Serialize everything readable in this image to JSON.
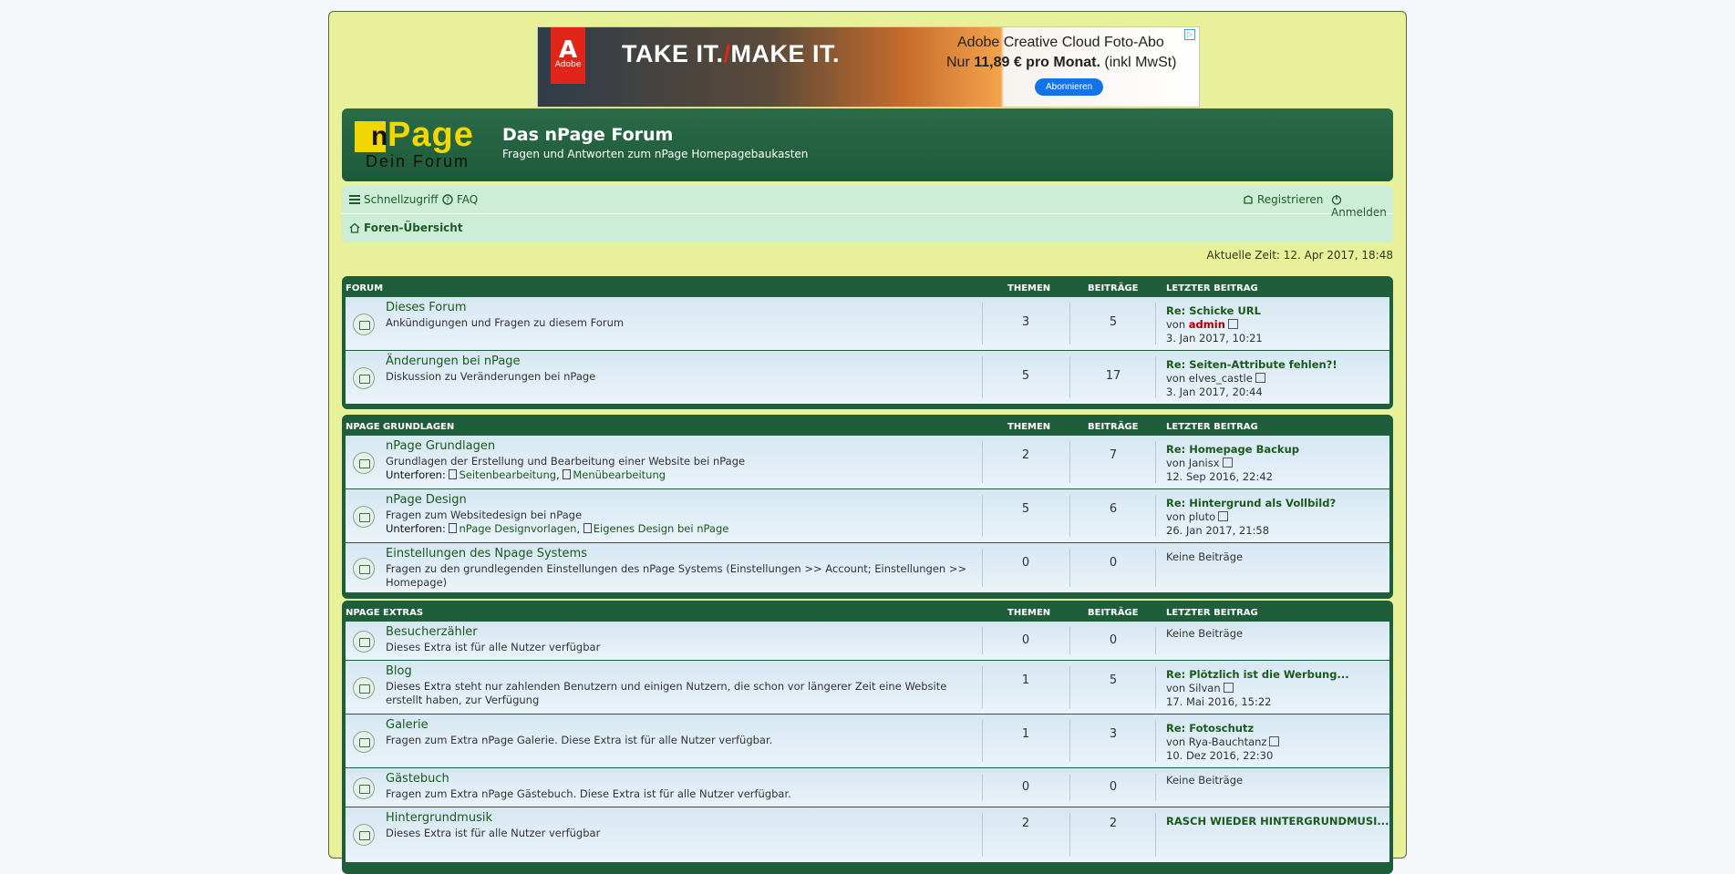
{
  "ad": {
    "logo_text": "Adobe",
    "headline_a": "TAKE IT.",
    "headline_b": "MAKE IT.",
    "line1": "Adobe Creative Cloud Foto-Abo",
    "line2_pre": "Nur ",
    "line2_price": "11,89 € pro Monat.",
    "line2_post": " (inkl MwSt)",
    "button": "Abonnieren"
  },
  "header": {
    "logo_n": "n",
    "logo_page": "Page",
    "logo_sub": "Dein Forum",
    "title": "Das nPage Forum",
    "subtitle": "Fragen und Antworten zum nPage Homepagebaukasten"
  },
  "nav": {
    "quick": "Schnellzugriff",
    "faq": "FAQ",
    "register": "Registrieren",
    "login": "Anmelden",
    "breadcrumb": "Foren-Übersicht"
  },
  "current_time": "Aktuelle Zeit: 12. Apr 2017, 18:48",
  "columns": {
    "topics": "THEMEN",
    "posts": "BEITRÄGE",
    "last": "LETZTER BEITRAG"
  },
  "categories": [
    {
      "name": "FORUM",
      "forums": [
        {
          "title": "Dieses Forum",
          "desc": "Ankündigungen und Fragen zu diesem Forum",
          "topics": "3",
          "posts": "5",
          "last_title": "Re: Schicke URL",
          "by": "von ",
          "author": "admin",
          "date": "3. Jan 2017, 10:21"
        },
        {
          "title": "Änderungen bei nPage",
          "desc": "Diskussion zu Veränderungen bei nPage",
          "topics": "5",
          "posts": "17",
          "last_title": "Re: Seiten-Attribute fehlen?!",
          "by": "von ",
          "author": "elves_castle",
          "date": "3. Jan 2017, 20:44"
        }
      ]
    },
    {
      "name": "NPAGE GRUNDLAGEN",
      "forums": [
        {
          "title": "nPage Grundlagen",
          "desc": "Grundlagen der Erstellung und Bearbeitung einer Website bei nPage",
          "sub_label": "Unterforen:",
          "sub1": "Seitenbearbeitung",
          "sub2": "Menübearbeitung",
          "topics": "2",
          "posts": "7",
          "last_title": "Re: Homepage Backup",
          "by": "von ",
          "author": "Janisx",
          "date": "12. Sep 2016, 22:42"
        },
        {
          "title": "nPage Design",
          "desc": "Fragen zum Websitedesign bei nPage",
          "sub_label": "Unterforen:",
          "sub1": "nPage Designvorlagen",
          "sub2": "Eigenes Design bei nPage",
          "topics": "5",
          "posts": "6",
          "last_title": "Re: Hintergrund als Vollbild?",
          "by": "von ",
          "author": "pluto",
          "date": "26. Jan 2017, 21:58"
        },
        {
          "title": "Einstellungen des Npage Systems",
          "desc": "Fragen zu den grundlegenden Einstellungen des nPage Systems (Einstellungen >> Account; Einstellungen >> Homepage)",
          "topics": "0",
          "posts": "0",
          "none": "Keine Beiträge"
        }
      ]
    },
    {
      "name": "NPAGE EXTRAS",
      "forums": [
        {
          "title": "Besucherzähler",
          "desc": "Dieses Extra ist für alle Nutzer verfügbar",
          "topics": "0",
          "posts": "0",
          "none": "Keine Beiträge"
        },
        {
          "title": "Blog",
          "desc": "Dieses Extra steht nur zahlenden Benutzern und einigen Nutzern, die schon vor längerer Zeit eine Website erstellt haben, zur Verfügung",
          "topics": "1",
          "posts": "5",
          "last_title": "Re: Plötzlich ist die Werbung...",
          "by": "von ",
          "author": "Silvan",
          "date": "17. Mai 2016, 15:22"
        },
        {
          "title": "Galerie",
          "desc": "Fragen zum Extra nPage Galerie. Diese Extra ist für alle Nutzer verfügbar.",
          "topics": "1",
          "posts": "3",
          "last_title": "Re: Fotoschutz",
          "by": "von ",
          "author": "Rya-Bauchtanz",
          "date": "10. Dez 2016, 22:30"
        },
        {
          "title": "Gästebuch",
          "desc": "Fragen zum Extra nPage Gästebuch. Diese Extra ist für alle Nutzer verfügbar.",
          "topics": "0",
          "posts": "0",
          "none": "Keine Beiträge"
        },
        {
          "title": "Hintergrundmusik",
          "desc": "Dieses Extra ist für alle Nutzer verfügbar",
          "topics": "2",
          "posts": "2",
          "last_title": "RASCH WIEDER HINTERGRUNDMUSI..."
        }
      ]
    }
  ]
}
